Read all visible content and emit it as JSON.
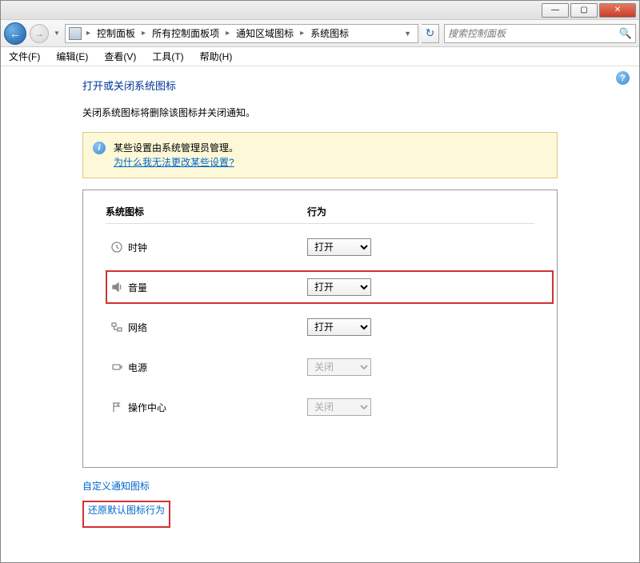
{
  "titlebar": {
    "minimize": "—",
    "maximize": "▢",
    "close": "✕"
  },
  "nav": {
    "back": "←",
    "forward": "→"
  },
  "breadcrumbs": {
    "items": [
      "控制面板",
      "所有控制面板项",
      "通知区域图标",
      "系统图标"
    ]
  },
  "search": {
    "placeholder": "搜索控制面板"
  },
  "menu": {
    "items": [
      "文件(F)",
      "编辑(E)",
      "查看(V)",
      "工具(T)",
      "帮助(H)"
    ]
  },
  "page": {
    "title": "打开或关闭系统图标",
    "description": "关闭系统图标将删除该图标并关闭通知。",
    "info_text": "某些设置由系统管理员管理。",
    "info_link": "为什么我无法更改某些设置?",
    "help_icon": "?"
  },
  "table": {
    "col_system": "系统图标",
    "col_behavior": "行为",
    "rows": [
      {
        "icon": "clock",
        "label": "时钟",
        "value": "打开",
        "enabled": true,
        "highlight": false
      },
      {
        "icon": "volume",
        "label": "音量",
        "value": "打开",
        "enabled": true,
        "highlight": true
      },
      {
        "icon": "network",
        "label": "网络",
        "value": "打开",
        "enabled": true,
        "highlight": false
      },
      {
        "icon": "power",
        "label": "电源",
        "value": "关闭",
        "enabled": false,
        "highlight": false
      },
      {
        "icon": "flag",
        "label": "操作中心",
        "value": "关闭",
        "enabled": false,
        "highlight": false
      }
    ],
    "select_options": [
      "打开",
      "关闭"
    ]
  },
  "links": {
    "customize": "自定义通知图标",
    "restore": "还原默认图标行为"
  }
}
